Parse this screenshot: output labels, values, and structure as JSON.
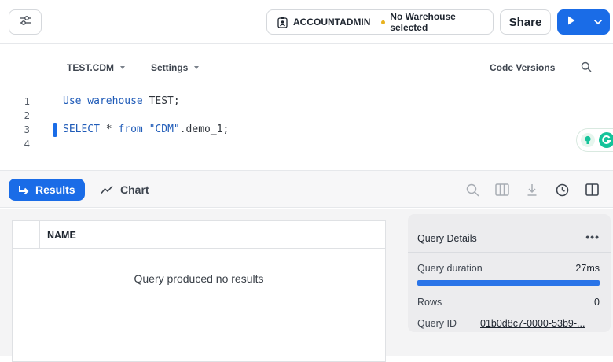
{
  "topbar": {
    "role": "ACCOUNTADMIN",
    "warehouse_status": "No Warehouse selected",
    "share_label": "Share",
    "icons": {
      "filter": "sliders-icon",
      "role": "id-badge-icon",
      "run": "play-icon",
      "menu": "chevron-down-icon"
    },
    "colors": {
      "accent": "#1a6ce7",
      "warning_dot": "#e8b21f"
    }
  },
  "context": {
    "database": "TEST.CDM",
    "settings": "Settings",
    "code_versions": "Code Versions"
  },
  "editor": {
    "lines": [
      {
        "num": "1",
        "text": "Use warehouse TEST;"
      },
      {
        "num": "2",
        "text": ""
      },
      {
        "num": "3",
        "text": "SELECT * from \"CDM\".demo_1;"
      },
      {
        "num": "4",
        "text": ""
      }
    ]
  },
  "results_bar": {
    "results_tab": "Results",
    "chart_tab": "Chart"
  },
  "results": {
    "column_header": "NAME",
    "empty_message": "Query produced no results"
  },
  "details": {
    "title": "Query Details",
    "more": "•••",
    "duration_label": "Query duration",
    "duration_value": "27ms",
    "duration_progress": 1.0,
    "rows_label": "Rows",
    "rows_value": "0",
    "query_id_label": "Query ID",
    "query_id_value": "01b0d8c7-0000-53b9-..."
  }
}
